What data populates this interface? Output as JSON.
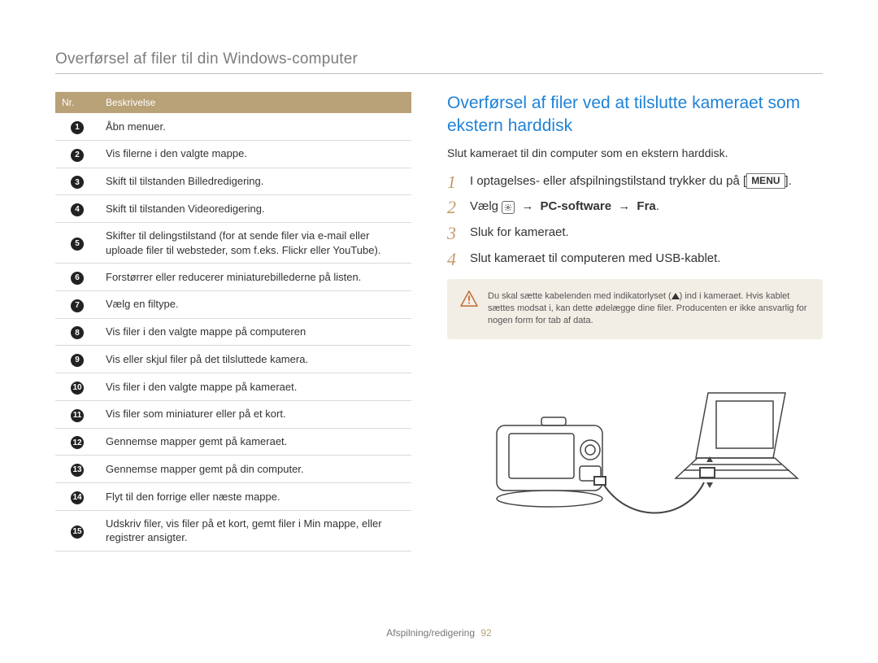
{
  "page_title": "Overførsel af filer til din Windows-computer",
  "table": {
    "headers": {
      "nr": "Nr.",
      "desc": "Beskrivelse"
    },
    "rows": [
      "Åbn menuer.",
      "Vis filerne i den valgte mappe.",
      "Skift til tilstanden Billedredigering.",
      "Skift til tilstanden Videoredigering.",
      "Skifter til delingstilstand (for at sende filer via e-mail eller uploade filer til websteder, som f.eks. Flickr eller YouTube).",
      "Forstørrer eller reducerer miniaturebillederne på listen.",
      "Vælg en filtype.",
      "Vis filer i den valgte mappe på computeren",
      "Vis eller skjul filer på det tilsluttede kamera.",
      "Vis filer i den valgte mappe på kameraet.",
      "Vis filer som miniaturer eller på et kort.",
      "Gennemse mapper gemt på kameraet.",
      "Gennemse mapper gemt på din computer.",
      "Flyt til den forrige eller næste mappe.",
      "Udskriv filer, vis filer på et kort, gemt filer i Min mappe, eller registrer ansigter."
    ]
  },
  "section_title": "Overførsel af filer ved at tilslutte kameraet som ekstern harddisk",
  "intro": "Slut kameraet til din computer som en ekstern harddisk.",
  "steps": {
    "s1a": "I optagelses- eller afspilningstilstand trykker du på",
    "s1b_menu": "MENU",
    "s2a": "Vælg",
    "s2b": "PC-software",
    "s2c": "Fra",
    "s3": "Sluk for kameraet.",
    "s4": "Slut kameraet til computeren med USB-kablet."
  },
  "warning": {
    "a": "Du skal sætte kabelenden med indikatorlyset (",
    "b": ") ind i kameraet. Hvis kablet sættes modsat i, kan dette ødelægge dine filer. Producenten er ikke ansvarlig for nogen form for tab af data."
  },
  "footer": {
    "section": "Afspilning/redigering",
    "page": "92"
  }
}
